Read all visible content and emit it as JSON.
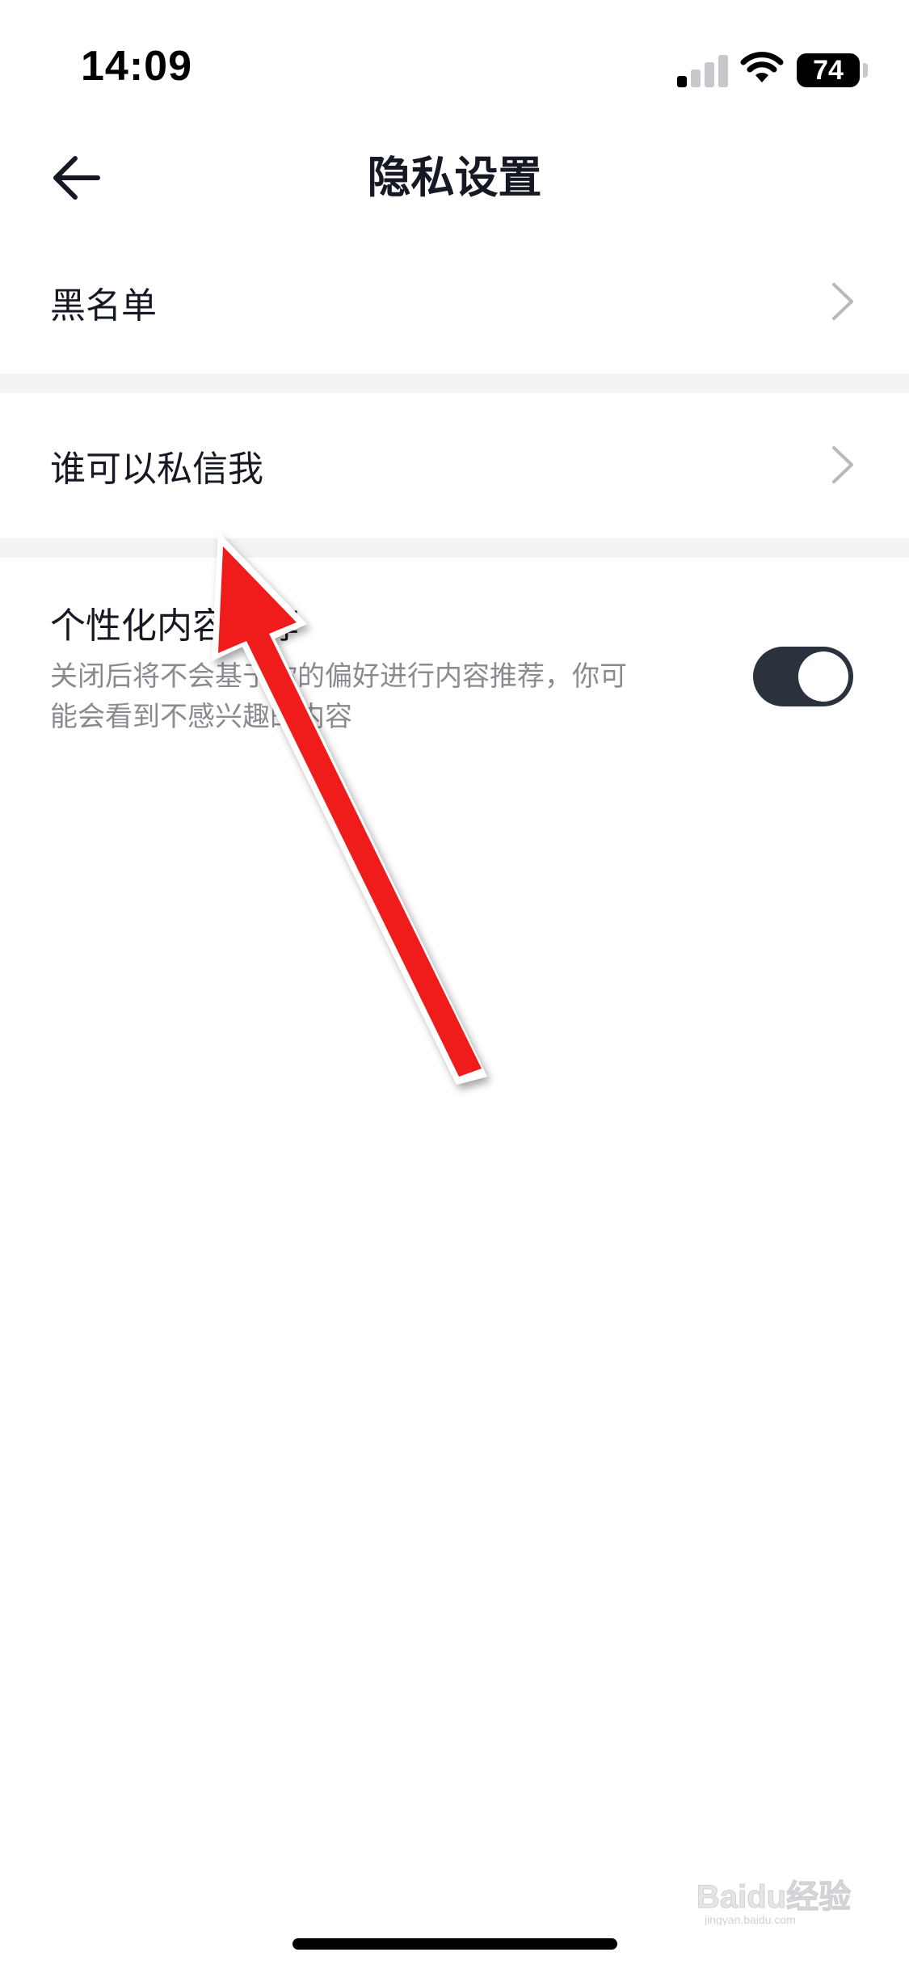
{
  "status_bar": {
    "time": "14:09",
    "battery_level": "74",
    "signal_bars_active": 1,
    "signal_bars_total": 4
  },
  "header": {
    "title": "隐私设置",
    "back_icon": "arrow-left-icon"
  },
  "settings": {
    "blacklist_label": "黑名单",
    "who_can_message_label": "谁可以私信我",
    "personalized_label": "个性化内容推荐",
    "personalized_desc_line1": "关闭后将不会基于你的偏好进行内容推荐，你可",
    "personalized_desc_line2": "能会看到不感兴趣的内容",
    "personalized_enabled": true
  },
  "colors": {
    "text_primary": "#161823",
    "text_secondary": "#8a8b91",
    "separator": "#f3f3f4",
    "toggle_on": "#2b323d",
    "annotation_arrow": "#f01a1a"
  },
  "watermark": {
    "brand": "Baidu经验",
    "sub": "jingyan.baidu.com"
  }
}
